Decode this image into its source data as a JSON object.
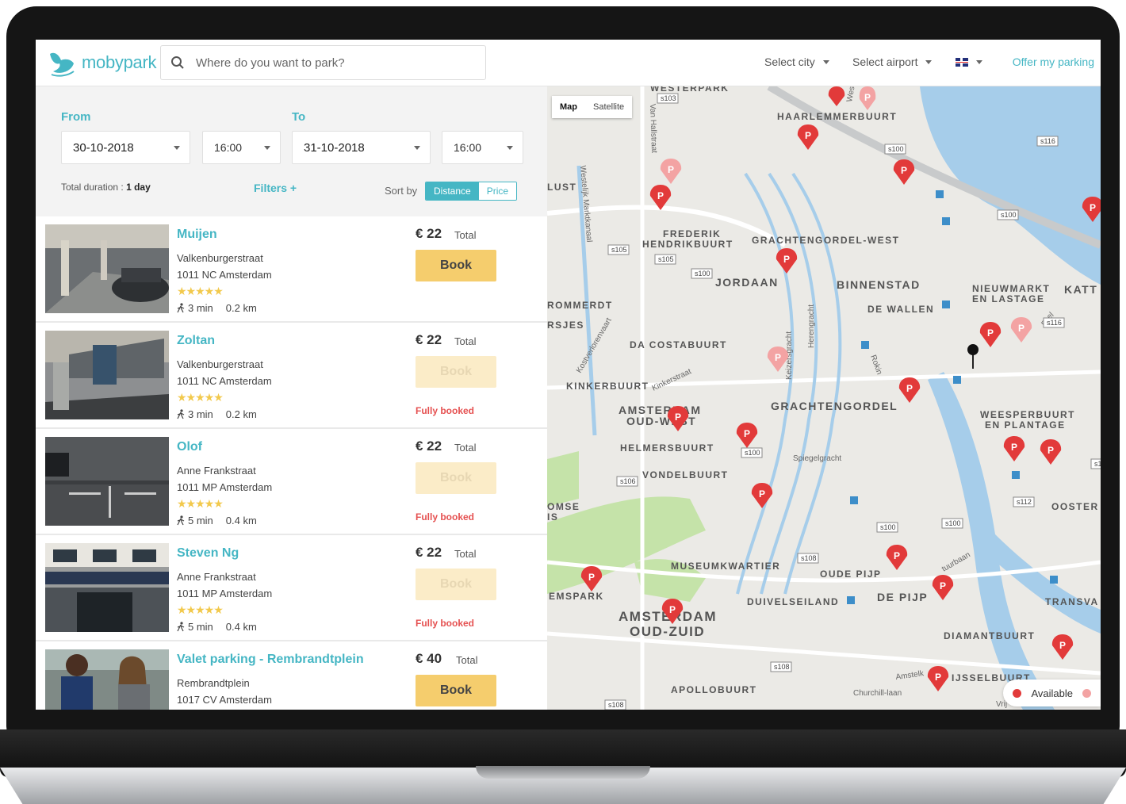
{
  "header": {
    "logo_text": "mobypark",
    "search_placeholder": "Where do you want to park?",
    "select_city": "Select city",
    "select_airport": "Select airport",
    "offer_label": "Offer my parking"
  },
  "filters": {
    "from_label": "From",
    "to_label": "To",
    "from_date": "30-10-2018",
    "from_time": "16:00",
    "to_date": "31-10-2018",
    "to_time": "16:00",
    "duration_label": "Total duration : ",
    "duration_value": "1 day",
    "filters_link": "Filters +",
    "sort_label": "Sort by",
    "sort_distance": "Distance",
    "sort_price": "Price"
  },
  "listings": [
    {
      "name": "Muijen",
      "street": "Valkenburgerstraat",
      "city": "1011 NC Amsterdam",
      "stars": "★★★★★",
      "walk": "3 min",
      "distance": "0.2 km",
      "price": "€ 22",
      "price_suffix": "Total",
      "book": "Book",
      "status": ""
    },
    {
      "name": "Zoltan",
      "street": "Valkenburgerstraat",
      "city": "1011 NC Amsterdam",
      "stars": "★★★★★",
      "walk": "3 min",
      "distance": "0.2 km",
      "price": "€ 22",
      "price_suffix": "Total",
      "book": "Book",
      "status": "Fully booked"
    },
    {
      "name": "Olof",
      "street": "Anne Frankstraat",
      "city": "1011 MP Amsterdam",
      "stars": "★★★★★",
      "walk": "5 min",
      "distance": "0.4 km",
      "price": "€ 22",
      "price_suffix": "Total",
      "book": "Book",
      "status": "Fully booked"
    },
    {
      "name": "Steven Ng",
      "street": "Anne Frankstraat",
      "city": "1011 MP Amsterdam",
      "stars": "★★★★★",
      "walk": "5 min",
      "distance": "0.4 km",
      "price": "€ 22",
      "price_suffix": "Total",
      "book": "Book",
      "status": "Fully booked"
    },
    {
      "name": "Valet parking - Rembrandtplein",
      "street": "Rembrandtplein",
      "city": "1017 CV Amsterdam",
      "stars": "",
      "walk": "",
      "distance": "",
      "price": "€ 40",
      "price_suffix": "Total",
      "book": "Book",
      "status": ""
    }
  ],
  "map": {
    "type_map": "Map",
    "type_satellite": "Satellite",
    "legend_available": "Available",
    "districts": [
      "HAARLEMMERBUURT",
      "FREDERIK",
      "HENDRIKBUURT",
      "GRACHTENGORDEL-WEST",
      "JORDAAN",
      "BINNENSTAD",
      "NIEUWMARKT",
      "EN LASTAGE",
      "KATT",
      "DE WALLEN",
      "ROMMERDT",
      "RSJES",
      "DA COSTABUURT",
      "KINKERBUURT",
      "AMSTERDAM",
      "OUD-WEST",
      "GRACHTENGORDEL",
      "WEESPERBUURT",
      "EN PLANTAGE",
      "HELMERSBUURT",
      "VONDELBUURT",
      "OMSE",
      "IS",
      "OOSTER",
      "MUSEUMKWARTIER",
      "OUDE PIJP",
      "DUIVELSEILAND",
      "DE PIJP",
      "TRANSVA",
      "EMSPARK",
      "AMSTERDAM",
      "OUD-ZUID",
      "DIAMANTBUURT",
      "IJSSELBUURT",
      "APOLLOBUURT",
      "LUST",
      "WESTERPARK"
    ],
    "streets": [
      "Van Hallstraat",
      "Westelijk Marktkanaal",
      "Kostverlorenvaart",
      "Kinkerstraat",
      "Keizersgracht",
      "Herengracht",
      "Rokin",
      "Spiegelgracht",
      "Amstelk",
      "Churchill-laan",
      "Vrij",
      "nnel",
      "tuurbaan",
      "Wes"
    ],
    "road_badges": [
      "s103",
      "s100",
      "s116",
      "s100",
      "s105",
      "s105",
      "s100",
      "s116",
      "s100",
      "s106",
      "s112",
      "s100",
      "s100",
      "s108",
      "s108",
      "s108",
      "s1"
    ]
  },
  "colors": {
    "brand": "#45b6c4",
    "book": "#f5cd6d",
    "marker": "#e23a3a",
    "marker_light": "#f3a3a3"
  }
}
